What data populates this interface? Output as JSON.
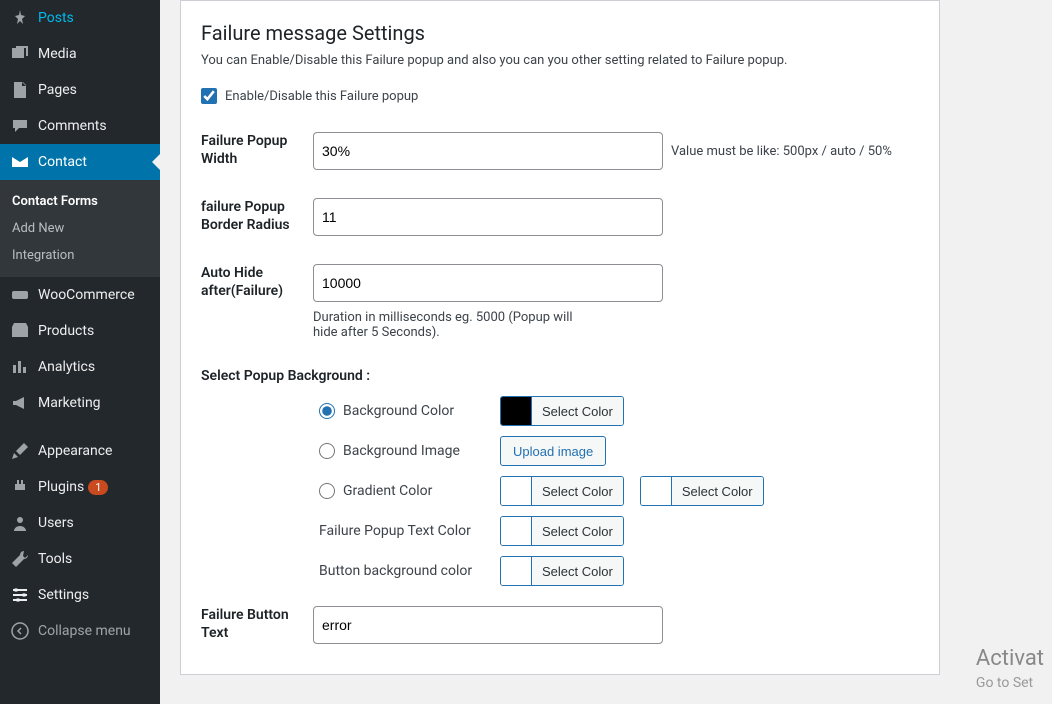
{
  "sidebar": {
    "items": [
      {
        "label": "Posts"
      },
      {
        "label": "Media"
      },
      {
        "label": "Pages"
      },
      {
        "label": "Comments"
      },
      {
        "label": "Contact"
      },
      {
        "label": "WooCommerce"
      },
      {
        "label": "Products"
      },
      {
        "label": "Analytics"
      },
      {
        "label": "Marketing"
      },
      {
        "label": "Appearance"
      },
      {
        "label": "Plugins"
      },
      {
        "label": "Users"
      },
      {
        "label": "Tools"
      },
      {
        "label": "Settings"
      }
    ],
    "plugin_badge": "1",
    "submenu": [
      {
        "label": "Contact Forms"
      },
      {
        "label": "Add New"
      },
      {
        "label": "Integration"
      }
    ],
    "collapse": "Collapse menu"
  },
  "form": {
    "title": "Failure message Settings",
    "desc": "You can Enable/Disable this Failure popup and also you can you other setting related to Failure popup.",
    "enable_label": "Enable/Disable this Failure popup",
    "width_label": "Failure Popup Width",
    "width_value": "30%",
    "width_hint": "Value must be like: 500px / auto / 50%",
    "radius_label": "failure Popup Border Radius",
    "radius_value": "11",
    "autohide_label": "Auto Hide after(Failure)",
    "autohide_value": "10000",
    "autohide_hint": "Duration in milliseconds eg. 5000 (Popup will hide after 5 Seconds).",
    "bg_label": "Select Popup Background :",
    "bg_color": "Background Color",
    "bg_image": "Background Image",
    "bg_gradient": "Gradient Color",
    "text_color_label": "Failure Popup Text Color",
    "btn_bg_label": "Button background color",
    "select_color": "Select Color",
    "upload_image": "Upload image",
    "btn_text_label": "Failure Button Text",
    "btn_text_value": "error"
  },
  "watermark": {
    "line1": "Activat",
    "line2": "Go to Set"
  }
}
